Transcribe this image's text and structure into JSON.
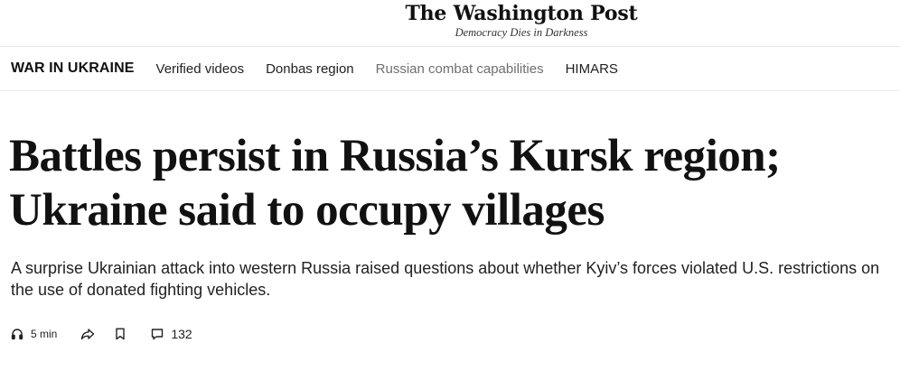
{
  "masthead": {
    "logo_text": "The Washington Post",
    "tagline": "Democracy Dies in Darkness"
  },
  "subnav": {
    "section_title": "WAR IN UKRAINE",
    "links": [
      {
        "label": "Verified videos"
      },
      {
        "label": "Donbas region"
      },
      {
        "label": "Russian combat capabilities"
      },
      {
        "label": "HIMARS"
      }
    ]
  },
  "article": {
    "headline": "Battles persist in Russia’s Kursk region; Ukraine said to occupy villages",
    "dek": "A surprise Ukrainian attack into western Russia raised questions about whether Kyiv’s forces violated U.S. restrictions on the use of donated fighting vehicles."
  },
  "toolbar": {
    "listen_label": "5 min",
    "comments_count": "132",
    "icons": {
      "listen": "headphones-icon",
      "share": "share-arrow-icon",
      "save": "bookmark-icon",
      "comments": "comment-bubble-icon"
    }
  }
}
